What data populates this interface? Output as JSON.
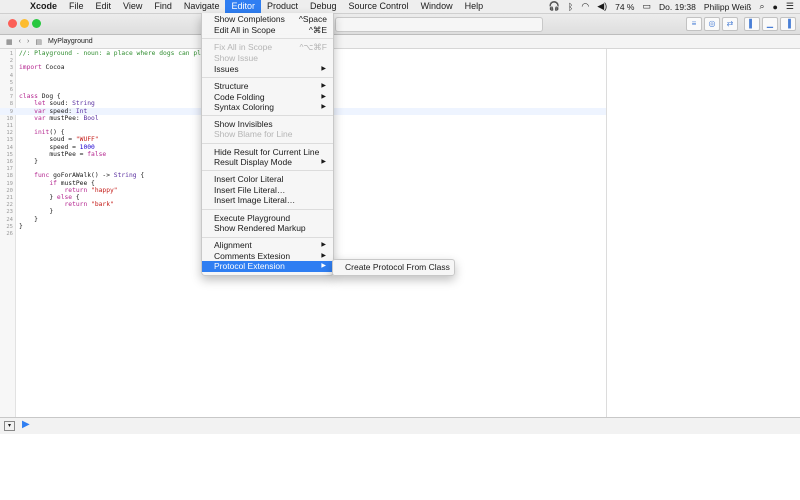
{
  "menubar": {
    "app": "Xcode",
    "items": [
      "File",
      "Edit",
      "View",
      "Find",
      "Navigate",
      "Editor",
      "Product",
      "Debug",
      "Source Control",
      "Window",
      "Help"
    ],
    "active": "Editor",
    "battery": "74 %",
    "clock": "Do. 19:38",
    "user": "Philipp Weiß"
  },
  "jumpbar": {
    "file": "MyPlayground"
  },
  "code": [
    "//: Playground - noun: a place where dogs can pl",
    "",
    "import Cocoa",
    "",
    "",
    "",
    "class Dog {",
    "    let soud: String",
    "    var speed: Int",
    "    var mustPee: Bool",
    "",
    "    init() {",
    "        soud = \"WUFF\"",
    "        speed = 1000",
    "        mustPee = false",
    "    }",
    "",
    "    func goForAWalk() -> String {",
    "        if mustPee {",
    "            return \"happy\"",
    "        } else {",
    "            return \"bark\"",
    "        }",
    "    }",
    "}",
    ""
  ],
  "editor_menu": {
    "show_completions": "Show Completions",
    "show_completions_sc": "^Space",
    "edit_all_in_scope": "Edit All in Scope",
    "edit_all_in_scope_sc": "^⌘E",
    "fix_all_in_scope": "Fix All in Scope",
    "fix_all_in_scope_sc": "^⌥⌘F",
    "show_issue": "Show Issue",
    "issues": "Issues",
    "structure": "Structure",
    "code_folding": "Code Folding",
    "syntax_coloring": "Syntax Coloring",
    "show_invisibles": "Show Invisibles",
    "show_blame": "Show Blame for Line",
    "hide_result": "Hide Result for Current Line",
    "result_display_mode": "Result Display Mode",
    "insert_color_literal": "Insert Color Literal",
    "insert_file_literal": "Insert File Literal…",
    "insert_image_literal": "Insert Image Literal…",
    "execute_playground": "Execute Playground",
    "show_rendered_markup": "Show Rendered Markup",
    "alignment": "Alignment",
    "comments_extension": "Comments Extesion",
    "protocol_extension": "Protocol Extension"
  },
  "submenu": {
    "create_protocol": "Create Protocol From Class"
  },
  "colors": {
    "accent": "#2f7ef2",
    "close": "#fc5f57",
    "minimize": "#fdbc2e",
    "zoom": "#28c840"
  }
}
